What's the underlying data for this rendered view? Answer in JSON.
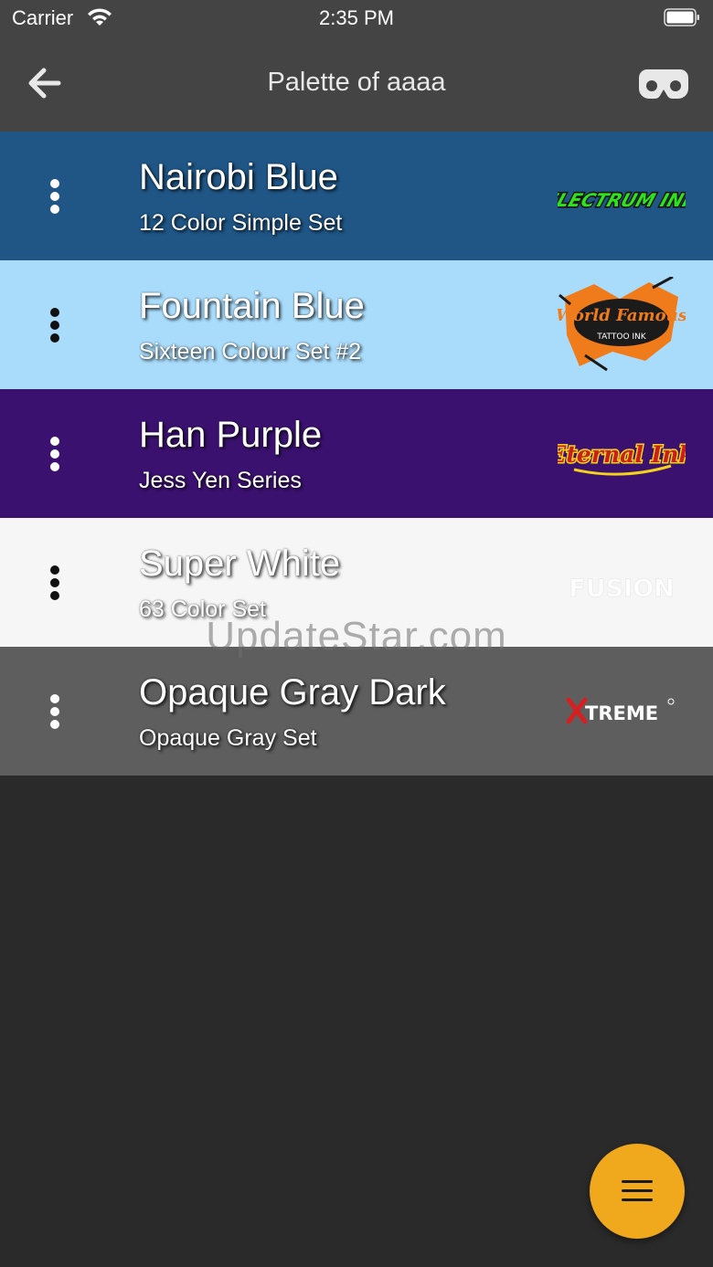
{
  "status_bar": {
    "carrier": "Carrier",
    "time": "2:35 PM"
  },
  "header": {
    "title": "Palette of aaaa",
    "back_icon": "arrow-left-icon",
    "action_icon": "vr-headset-icon"
  },
  "palettes": [
    {
      "name": "Nairobi Blue",
      "set": "12 Color Simple Set",
      "bg": "#1f5686",
      "dots": "#ffffff",
      "logo": "Electrum Ink"
    },
    {
      "name": "Fountain Blue",
      "set": "Sixteen Colour Set #2",
      "bg": "#a9dcfb",
      "dots": "#111111",
      "logo": "World Famous Tattoo Ink"
    },
    {
      "name": "Han Purple",
      "set": "Jess Yen Series",
      "bg": "#3b1170",
      "dots": "#ffffff",
      "logo": "Eternal Ink"
    },
    {
      "name": "Super White",
      "set": "63 Color Set",
      "bg": "#f6f6f6",
      "dots": "#111111",
      "logo": "Fusion"
    },
    {
      "name": "Opaque Gray Dark",
      "set": "Opaque Gray Set",
      "bg": "#5e5e5e",
      "dots": "#ffffff",
      "logo": "Xtreme"
    }
  ],
  "watermark": "UpdateStar.com",
  "fab": {
    "icon": "menu-icon",
    "color": "#f0a81c"
  }
}
